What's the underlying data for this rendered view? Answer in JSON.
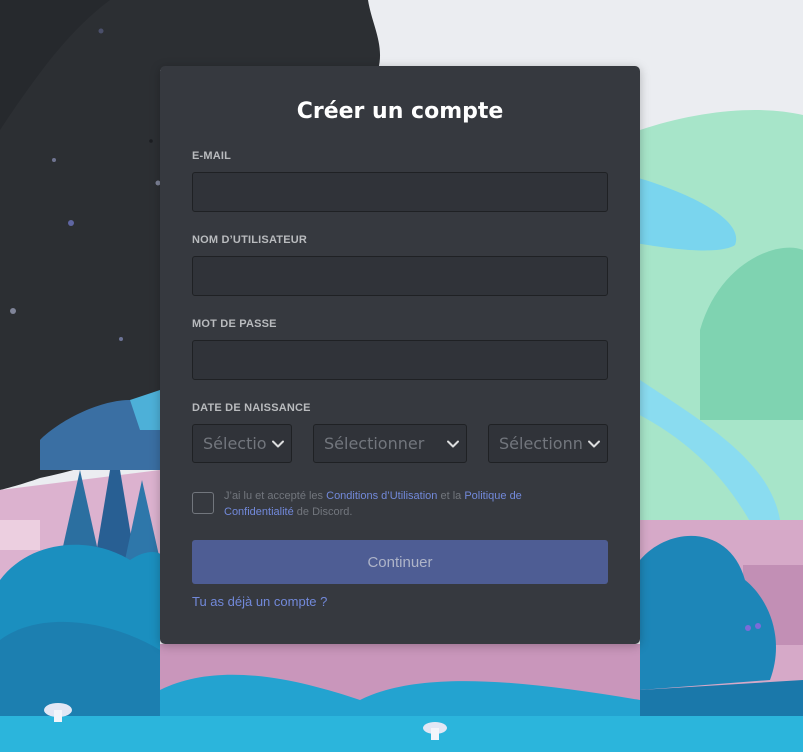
{
  "form": {
    "title": "Créer un compte",
    "email_label": "E-MAIL",
    "username_label": "NOM D’UTILISATEUR",
    "password_label": "MOT DE PASSE",
    "dob_label": "DATE DE NAISSANCE",
    "email_value": "",
    "username_value": "",
    "password_value": ""
  },
  "dob": {
    "day_text": "Sélectionner",
    "month_text": "Sélectionner",
    "year_text": "Sélectionner"
  },
  "terms": {
    "checked": false,
    "text_1": "J’ai lu et accepté les ",
    "tos_link": "Conditions d’Utilisation",
    "text_2": " et la ",
    "privacy_link": "Politique de Confidentialité",
    "text_3": " de Discord."
  },
  "actions": {
    "continue_label": "Continuer",
    "login_link": "Tu as déjà un compte ?"
  },
  "colors": {
    "card": "#36393f",
    "input_bg": "#303339",
    "accent": "#7289da",
    "button_disabled": "#4e5d94",
    "dark_panel": "#2c2f33"
  },
  "icons": {
    "select_chevron": "chevron-down-icon"
  }
}
